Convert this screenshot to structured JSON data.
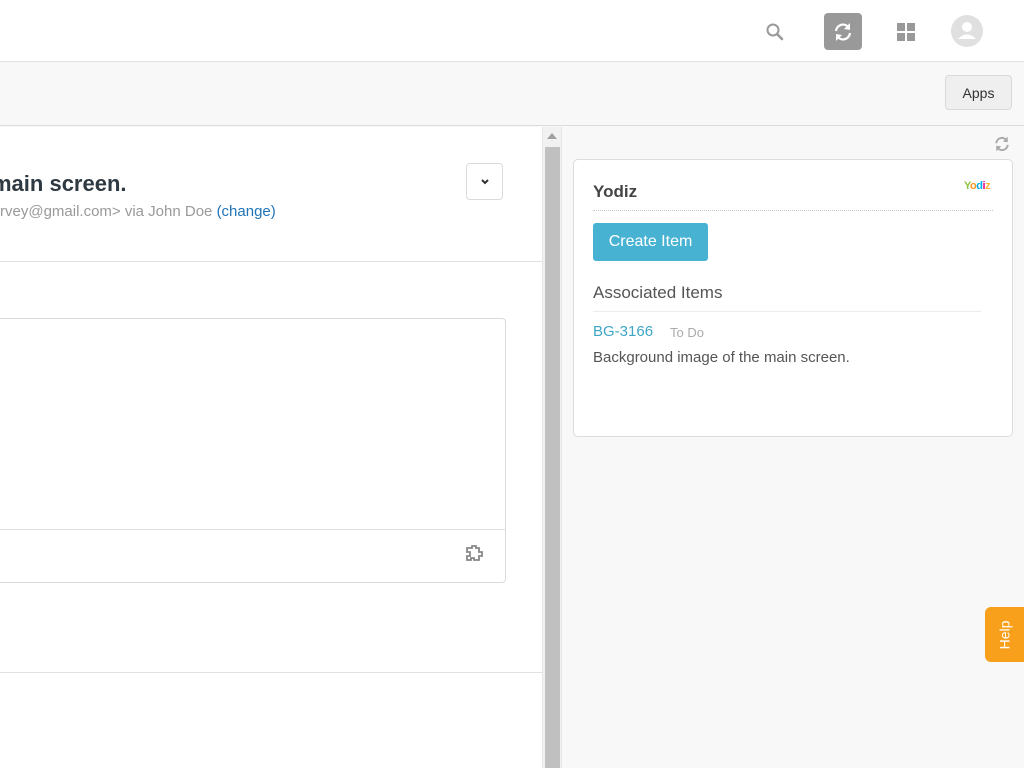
{
  "topbar": {
    "icons": [
      "search-icon",
      "sync-icon",
      "apps-grid-icon",
      "user-avatar-icon"
    ]
  },
  "subbar": {
    "apps_label": "Apps"
  },
  "ticket": {
    "title": "main screen.",
    "sender_text": "rvey@gmail.com> via John Doe ",
    "change_link": "(change)"
  },
  "sidebar": {
    "app_name": "Yodiz",
    "logo_text": "Yodiz",
    "create_button": "Create Item",
    "associated_heading": "Associated Items",
    "items": [
      {
        "id": "BG-3166",
        "status": "To Do",
        "description": "Background image of the main screen."
      }
    ]
  },
  "help": {
    "label": "Help"
  },
  "colors": {
    "accent": "#48b2d3",
    "link": "#1f73b7",
    "help": "#f8a01b"
  }
}
